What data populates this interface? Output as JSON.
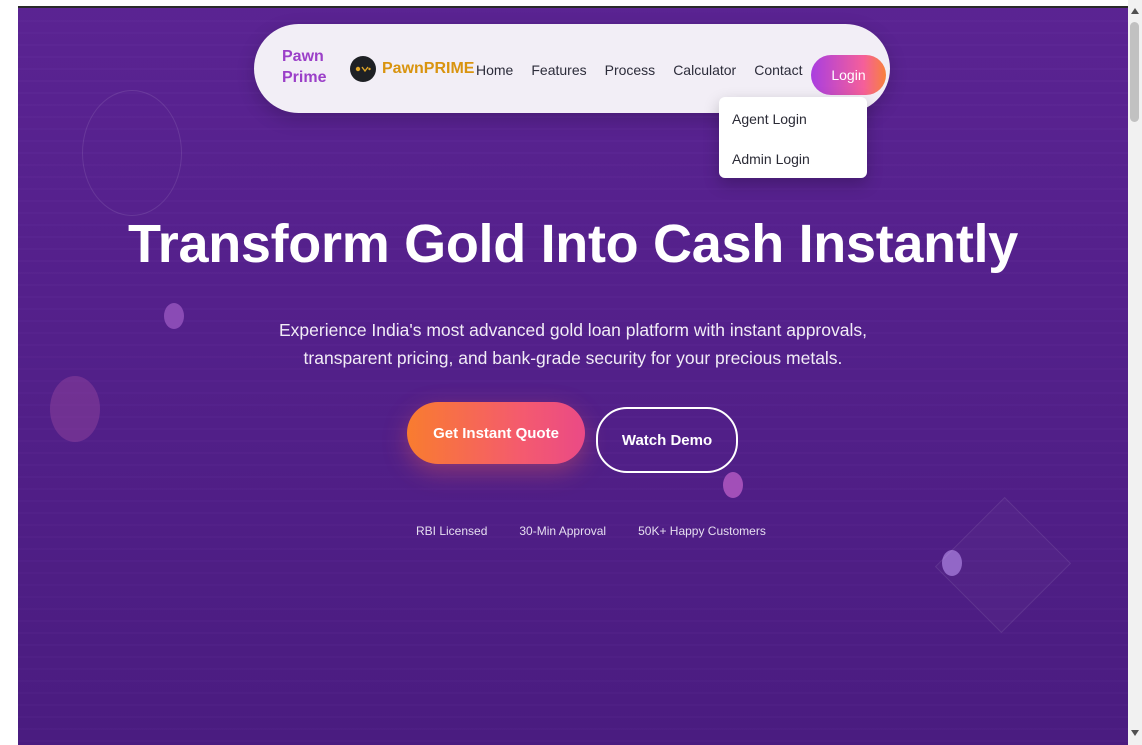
{
  "navbar": {
    "brand_text": "Pawn Prime",
    "logo_word": "PawnPRIME",
    "links": [
      "Home",
      "Features",
      "Process",
      "Calculator",
      "Contact"
    ],
    "login_label": "Login"
  },
  "dropdown": {
    "items": [
      "Agent Login",
      "Admin Login"
    ]
  },
  "hero": {
    "title": "Transform Gold Into Cash Instantly",
    "subtitle": "Experience India's most advanced gold loan platform with instant approvals, transparent pricing, and bank-grade security for your precious metals.",
    "primary_cta": "Get Instant Quote",
    "secondary_cta": "Watch Demo",
    "trust_items": [
      "RBI Licensed",
      "30-Min Approval",
      "50K+ Happy Customers"
    ]
  },
  "colors": {
    "hero_background": "#5b2494",
    "brand_purple": "#9b3fc8",
    "logo_gold": "#d9940f",
    "cta_orange": "#f97c2f",
    "cta_pink": "#ea4a86"
  }
}
